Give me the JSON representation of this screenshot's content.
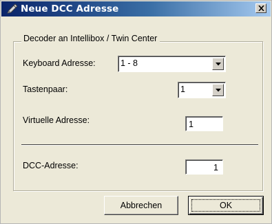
{
  "window": {
    "title": "Neue DCC Adresse",
    "close_symbol": "×"
  },
  "group": {
    "legend": "Decoder an Intellibox / Twin Center"
  },
  "fields": {
    "keyboard_label": "Keyboard Adresse:",
    "keyboard_value": "1 - 8",
    "tastenpaar_label": "Tastenpaar:",
    "tastenpaar_value": "1",
    "virtuelle_label": "Virtuelle Adresse:",
    "virtuelle_value": "1",
    "dcc_label": "DCC-Adresse:",
    "dcc_value": "1"
  },
  "buttons": {
    "cancel_label": "Abbrechen",
    "ok_label": "OK"
  },
  "colors": {
    "title_gradient_start": "#0a246a",
    "title_gradient_end": "#a6caf0",
    "dialog_bg": "#ece9d8"
  },
  "icons": {
    "app": "pen-icon",
    "close": "close-icon",
    "dropdown": "chevron-down-icon"
  }
}
